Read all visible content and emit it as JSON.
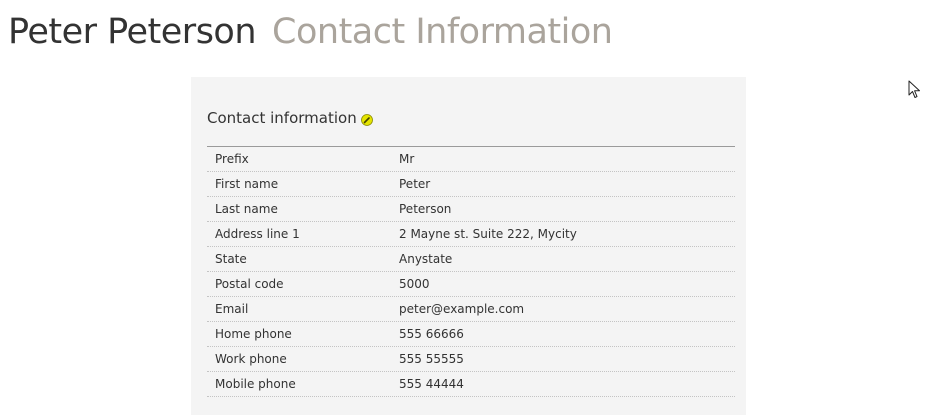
{
  "header": {
    "person_name": "Peter Peterson",
    "section_title": "Contact Information"
  },
  "panel": {
    "title": "Contact information",
    "edit_icon": "pencil-icon",
    "rows": [
      {
        "label": "Prefix",
        "value": "Mr"
      },
      {
        "label": "First name",
        "value": "Peter"
      },
      {
        "label": "Last name",
        "value": "Peterson"
      },
      {
        "label": "Address line 1",
        "value": "2 Mayne st. Suite 222, Mycity"
      },
      {
        "label": "State",
        "value": "Anystate"
      },
      {
        "label": "Postal code",
        "value": "5000"
      },
      {
        "label": "Email",
        "value": "peter@example.com"
      },
      {
        "label": "Home phone",
        "value": "555 66666"
      },
      {
        "label": "Work phone",
        "value": "555 55555"
      },
      {
        "label": "Mobile phone",
        "value": "555 44444"
      }
    ]
  },
  "colors": {
    "title_primary": "#333333",
    "title_secondary": "#aaa49c",
    "panel_background": "#f4f4f4",
    "edit_icon": "#d8d800"
  }
}
